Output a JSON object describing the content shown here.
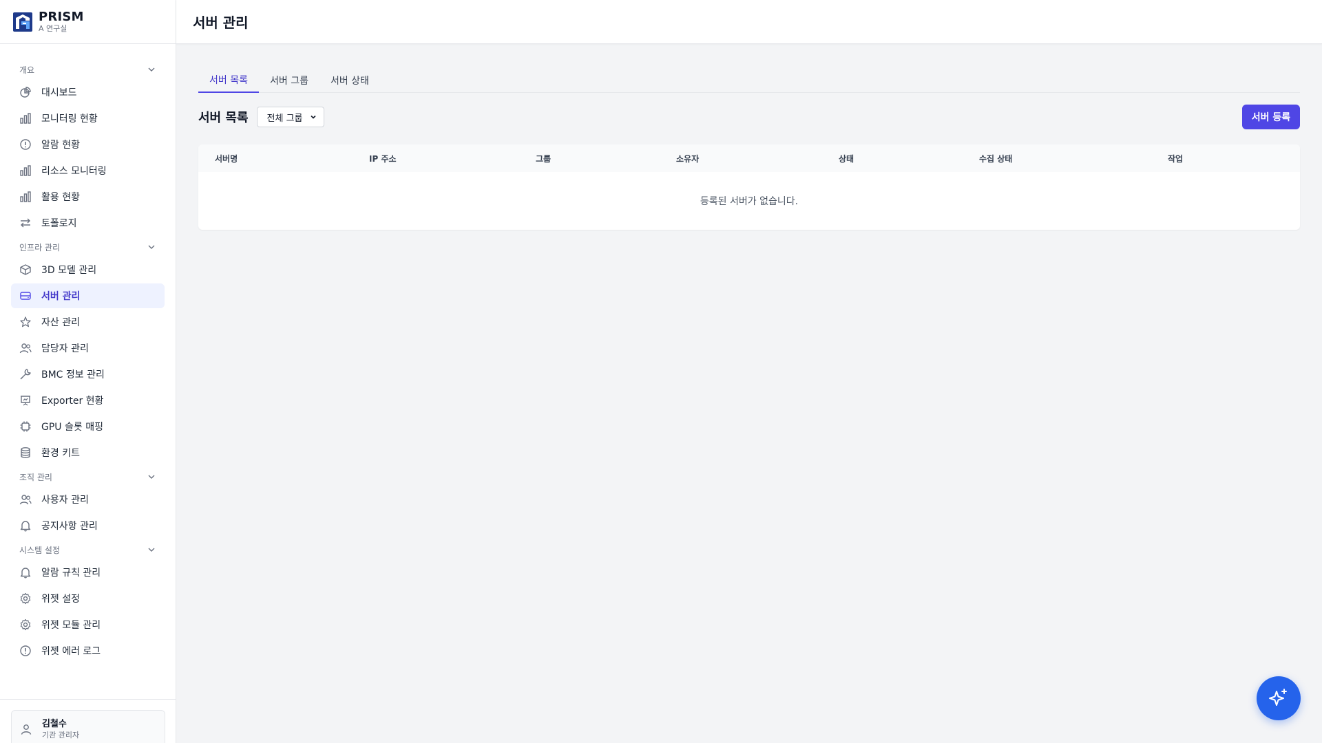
{
  "brand": {
    "name": "PRISM",
    "org": "A 연구실"
  },
  "header": {
    "title": "서버 관리"
  },
  "sidebar": {
    "sections": [
      {
        "label": "개요",
        "items": [
          {
            "label": "대시보드",
            "icon": "pie-chart-icon"
          },
          {
            "label": "모니터링 현황",
            "icon": "bar-chart-icon"
          },
          {
            "label": "알람 현황",
            "icon": "alert-circle-icon"
          },
          {
            "label": "리소스 모니터링",
            "icon": "bar-chart-icon"
          },
          {
            "label": "활용 현황",
            "icon": "bar-chart-icon"
          },
          {
            "label": "토폴로지",
            "icon": "arrows-swap-icon"
          }
        ]
      },
      {
        "label": "인프라 관리",
        "items": [
          {
            "label": "3D 모델 관리",
            "icon": "cube-icon"
          },
          {
            "label": "서버 관리",
            "icon": "server-icon",
            "active": true
          },
          {
            "label": "자산 관리",
            "icon": "star-icon"
          },
          {
            "label": "담당자 관리",
            "icon": "users-icon"
          },
          {
            "label": "BMC 정보 관리",
            "icon": "wrench-icon"
          },
          {
            "label": "Exporter 현황",
            "icon": "presentation-chart-icon"
          },
          {
            "label": "GPU 슬롯 매핑",
            "icon": "chip-icon"
          },
          {
            "label": "환경 키트",
            "icon": "database-icon"
          }
        ]
      },
      {
        "label": "조직 관리",
        "items": [
          {
            "label": "사용자 관리",
            "icon": "users-icon"
          },
          {
            "label": "공지사항 관리",
            "icon": "bell-icon"
          }
        ]
      },
      {
        "label": "시스템 설정",
        "items": [
          {
            "label": "알람 규칙 관리",
            "icon": "bell-icon"
          },
          {
            "label": "위젯 설정",
            "icon": "gear-icon"
          },
          {
            "label": "위젯 모듈 관리",
            "icon": "gear-icon"
          },
          {
            "label": "위젯 에러 로그",
            "icon": "alert-circle-icon"
          }
        ]
      }
    ]
  },
  "user": {
    "name": "김철수",
    "role": "기관 관리자"
  },
  "tabs": [
    {
      "label": "서버 목록",
      "active": true
    },
    {
      "label": "서버 그룹"
    },
    {
      "label": "서버 상태"
    }
  ],
  "list": {
    "title": "서버 목록",
    "group_select": "전체 그룹",
    "add_button": "서버 등록"
  },
  "table": {
    "columns": [
      "서버명",
      "IP 주소",
      "그룹",
      "소유자",
      "상태",
      "수집 상태",
      "작업"
    ],
    "empty_message": "등록된 서버가 없습니다."
  },
  "colors": {
    "accent": "#4f46e5",
    "fab": "#2563eb",
    "active_bg": "#eef2ff"
  },
  "fab": {
    "icon": "sparkle-icon"
  }
}
